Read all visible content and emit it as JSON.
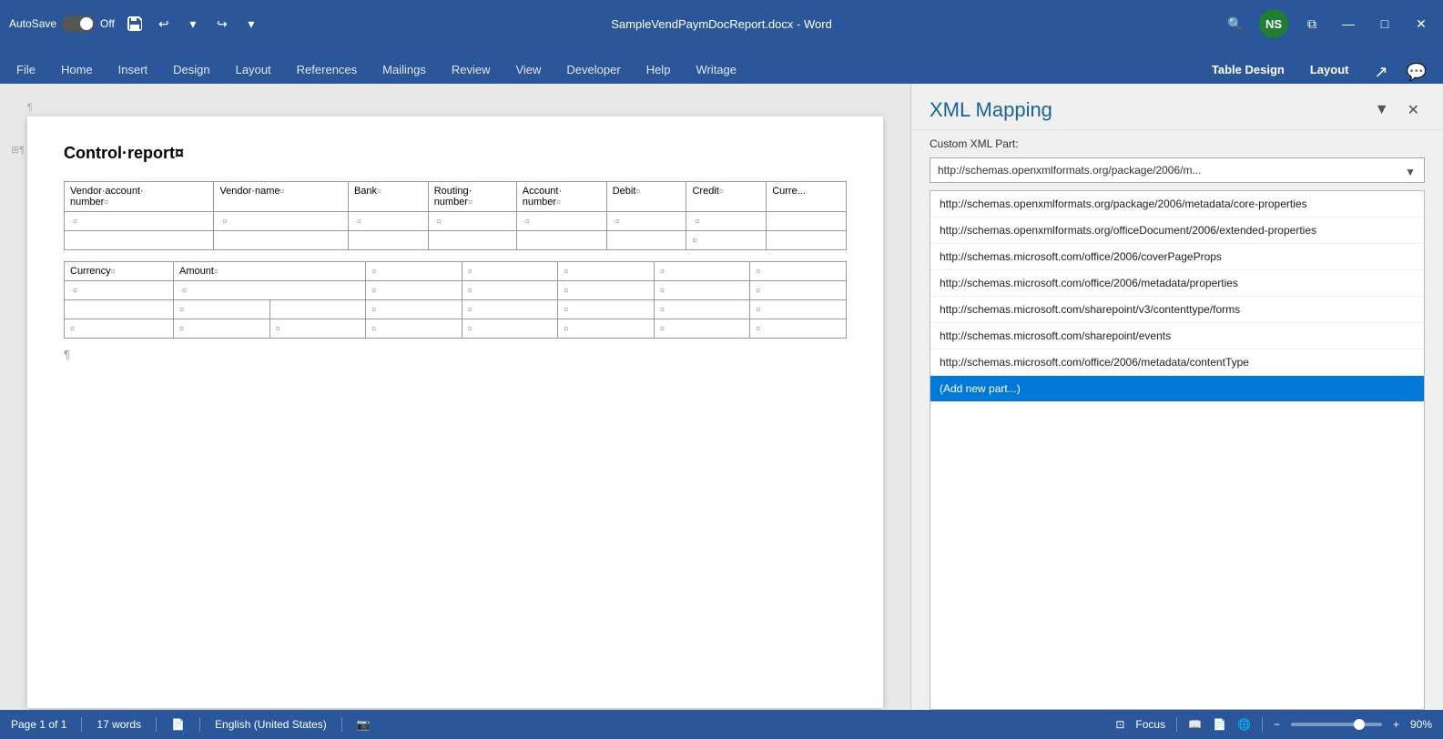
{
  "titlebar": {
    "autosave_label": "AutoSave",
    "toggle_state": "Off",
    "filename": "SampleVendPaymDocReport.docx",
    "app_name": "Word",
    "user_initials": "NS",
    "search_placeholder": "Search"
  },
  "ribbon": {
    "tabs": [
      {
        "id": "file",
        "label": "File",
        "active": false
      },
      {
        "id": "home",
        "label": "Home",
        "active": false
      },
      {
        "id": "insert",
        "label": "Insert",
        "active": false
      },
      {
        "id": "design",
        "label": "Design",
        "active": false
      },
      {
        "id": "layout",
        "label": "Layout",
        "active": false
      },
      {
        "id": "references",
        "label": "References",
        "active": false
      },
      {
        "id": "mailings",
        "label": "Mailings",
        "active": false
      },
      {
        "id": "review",
        "label": "Review",
        "active": false
      },
      {
        "id": "view",
        "label": "View",
        "active": false
      },
      {
        "id": "developer",
        "label": "Developer",
        "active": false
      },
      {
        "id": "help",
        "label": "Help",
        "active": false
      },
      {
        "id": "writage",
        "label": "Writage",
        "active": false
      },
      {
        "id": "table-design",
        "label": "Table Design",
        "active": false
      },
      {
        "id": "layout2",
        "label": "Layout",
        "active": false
      }
    ]
  },
  "document": {
    "title": "Control·report¤",
    "para_mark": "¶",
    "table": {
      "headers": [
        "Vendor·account·number¤",
        "Vendor·name¤",
        "Bank¤",
        "Routing·number¤",
        "Account·number¤",
        "Debit¤",
        "Credit¤",
        "Curre..."
      ],
      "rows": [
        [
          "·¤",
          "·¤",
          "·¤",
          "·¤",
          "·¤",
          "·¤",
          "·¤",
          ""
        ],
        [
          "",
          "",
          "",
          "",
          "",
          "",
          "¤",
          ""
        ],
        [
          "Currency¤",
          "",
          "Amount¤",
          "",
          "¤",
          "¤",
          "¤",
          "¤"
        ],
        [
          "·¤",
          "",
          "·¤",
          "",
          "¤",
          "¤",
          "¤",
          "¤"
        ],
        [
          "",
          "¤",
          "",
          "¤",
          "¤",
          "¤",
          "¤",
          "¤"
        ],
        [
          "¤",
          "¤",
          "¤",
          "¤",
          "¤",
          "¤",
          "¤",
          "¤"
        ]
      ]
    }
  },
  "xml_panel": {
    "title": "XML Mapping",
    "label": "Custom XML Part:",
    "selected_value": "http://schemas.openxmlformats.org/package/2006/m...",
    "items": [
      {
        "id": "item1",
        "label": "http://schemas.openxmlformats.org/package/2006/metadata/core-properties",
        "selected": false
      },
      {
        "id": "item2",
        "label": "http://schemas.openxmlformats.org/officeDocument/2006/extended-properties",
        "selected": false
      },
      {
        "id": "item3",
        "label": "http://schemas.microsoft.com/office/2006/coverPageProps",
        "selected": false
      },
      {
        "id": "item4",
        "label": "http://schemas.microsoft.com/office/2006/metadata/properties",
        "selected": false
      },
      {
        "id": "item5",
        "label": "http://schemas.microsoft.com/sharepoint/v3/contenttype/forms",
        "selected": false
      },
      {
        "id": "item6",
        "label": "http://schemas.microsoft.com/sharepoint/events",
        "selected": false
      },
      {
        "id": "item7",
        "label": "http://schemas.microsoft.com/office/2006/metadata/contentType",
        "selected": false
      },
      {
        "id": "item8",
        "label": "(Add new part...)",
        "selected": true
      }
    ]
  },
  "statusbar": {
    "page_info": "Page 1 of 1",
    "word_count": "17 words",
    "language": "English (United States)",
    "focus_label": "Focus",
    "zoom_level": "90%"
  }
}
